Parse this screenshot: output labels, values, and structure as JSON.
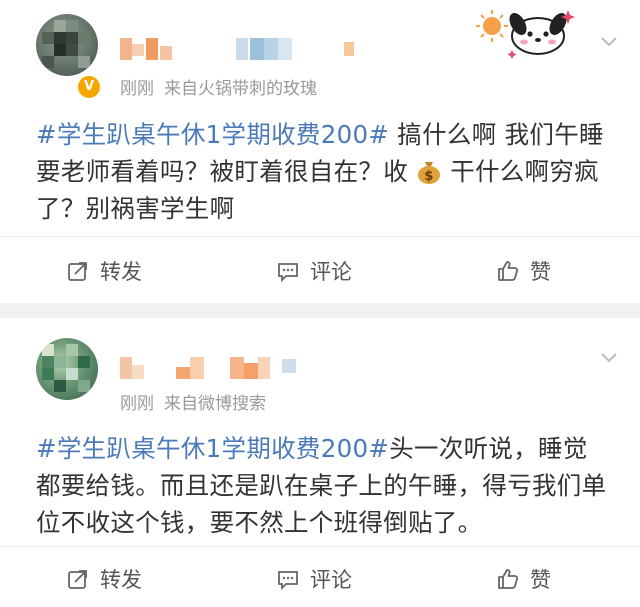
{
  "posts": [
    {
      "meta_time": "刚刚",
      "meta_source": "来自火锅带刺的玫瑰",
      "hashtag": "#学生趴桌午休1学期收费200#",
      "text_before_emoji": " 搞什么啊 我们午睡要老师看着吗？被盯着很自在？收",
      "emoji": "money-bag",
      "text_after_emoji": "干什么啊穷疯了？别祸害学生啊",
      "actions": {
        "repost": "转发",
        "comment": "评论",
        "like": "赞"
      }
    },
    {
      "meta_time": "刚刚",
      "meta_source": "来自微博搜索",
      "hashtag": "#学生趴桌午休1学期收费200#",
      "text": "头一次听说，睡觉都要给钱。而且还是趴在桌子上的午睡，得亏我们单位不收这个钱，要不然上个班得倒贴了。",
      "actions": {
        "repost": "转发",
        "comment": "评论",
        "like": "赞"
      }
    }
  ],
  "colors": {
    "hashtag": "#4a7ab8",
    "text": "#333333",
    "meta": "#9a9a9a",
    "background": "#f1f1f1",
    "verified_badge": "#f7a600"
  }
}
